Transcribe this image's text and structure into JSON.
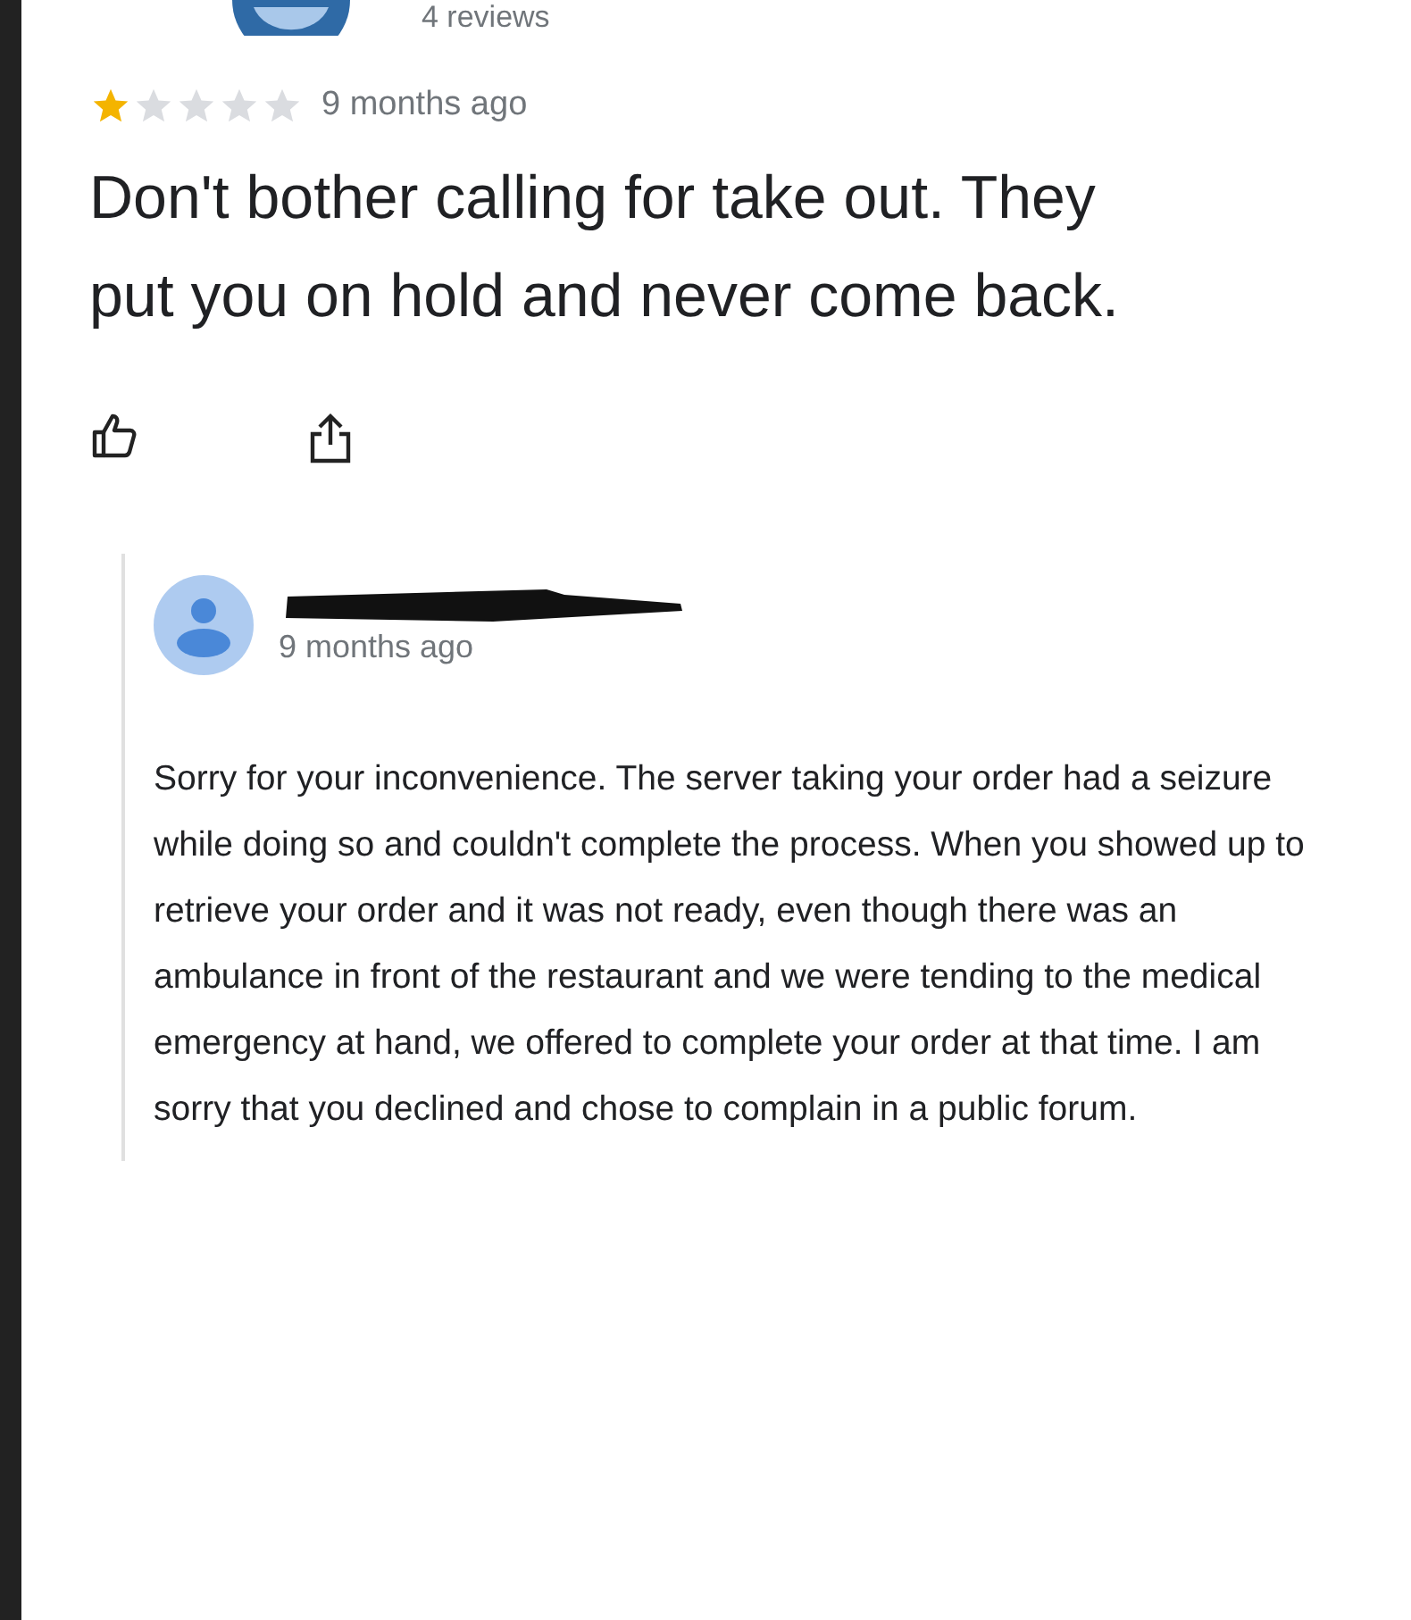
{
  "reviewer": {
    "review_count": "4 reviews"
  },
  "review": {
    "stars": 1,
    "time": "9 months ago",
    "text": "Don't bother calling for take out. They put you on hold and never come back."
  },
  "owner_response": {
    "name_redacted": true,
    "time": "9 months ago",
    "text": "Sorry for your inconvenience.  The server taking your order had a seizure while doing so and couldn't complete the process.  When you showed up to retrieve your order and it was not ready, even though there was an ambulance in front of the restaurant and we were tending to the medical emergency at hand, we offered to complete your order at that time.  I am sorry that you declined and chose to complain in a public forum."
  }
}
